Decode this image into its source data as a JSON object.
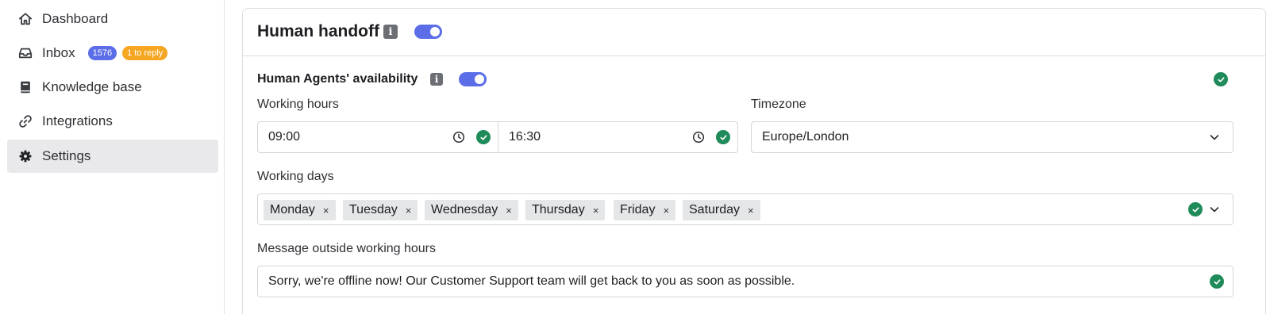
{
  "sidebar": {
    "items": [
      {
        "label": "Dashboard",
        "icon": "home-icon"
      },
      {
        "label": "Inbox",
        "icon": "inbox-icon",
        "badge_count": "1576",
        "badge_reply": "1 to reply"
      },
      {
        "label": "Knowledge base",
        "icon": "book-icon"
      },
      {
        "label": "Integrations",
        "icon": "link-icon"
      },
      {
        "label": "Settings",
        "icon": "gear-icon",
        "active": true
      }
    ]
  },
  "handoff": {
    "title": "Human handoff",
    "info": "i",
    "enabled": true,
    "availability": {
      "title": "Human Agents' availability",
      "info": "i",
      "enabled": true
    },
    "working_hours": {
      "label": "Working hours",
      "start": "09:00",
      "end": "16:30"
    },
    "timezone": {
      "label": "Timezone",
      "value": "Europe/London"
    },
    "working_days": {
      "label": "Working days",
      "days": [
        "Monday",
        "Tuesday",
        "Wednesday",
        "Thursday",
        "Friday",
        "Saturday"
      ],
      "remove_glyph": "×"
    },
    "offline_message": {
      "label": "Message outside working hours",
      "value": "Sorry, we're offline now! Our Customer Support team will get back to you as soon as possible."
    }
  },
  "colors": {
    "accent": "#5b6ee8",
    "success": "#1f8a5a",
    "warning": "#f5a623"
  }
}
